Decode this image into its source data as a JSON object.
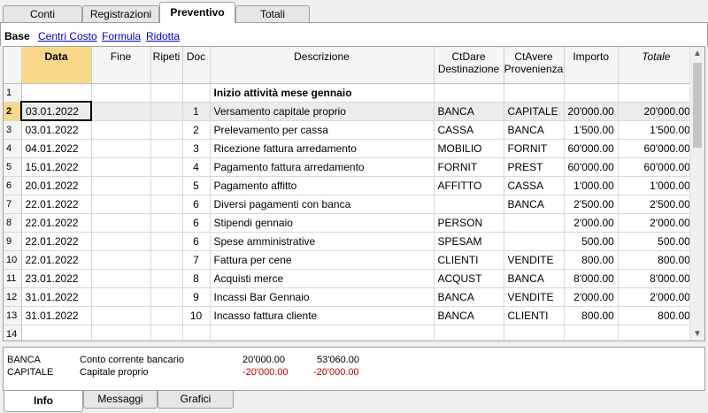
{
  "top_tabs": [
    "Conti",
    "Registrazioni",
    "Preventivo",
    "Totali"
  ],
  "active_top_tab": "Preventivo",
  "views": {
    "base": "Base",
    "links": [
      "Centri Costo",
      "Formula",
      "Ridotta"
    ]
  },
  "columns": [
    {
      "label": "Data"
    },
    {
      "label": "Fine"
    },
    {
      "label": "Ripeti"
    },
    {
      "label": "Doc"
    },
    {
      "label": "Descrizione"
    },
    {
      "label": "CtDare Destinazione"
    },
    {
      "label": "CtAvere Provenienza"
    },
    {
      "label": "Importo"
    },
    {
      "label": "Totale"
    }
  ],
  "rows": [
    {
      "n": "1",
      "data": "",
      "fine": "",
      "ripeti": "",
      "doc": "",
      "desc": "Inizio attività mese gennaio",
      "dare": "",
      "avere": "",
      "importo": "",
      "totale": ""
    },
    {
      "n": "2",
      "data": "03.01.2022",
      "fine": "",
      "ripeti": "",
      "doc": "1",
      "desc": "Versamento capitale proprio",
      "dare": "BANCA",
      "avere": "CAPITALE",
      "importo": "20'000.00",
      "totale": "20'000.00"
    },
    {
      "n": "3",
      "data": "03.01.2022",
      "fine": "",
      "ripeti": "",
      "doc": "2",
      "desc": "Prelevamento per cassa",
      "dare": "CASSA",
      "avere": "BANCA",
      "importo": "1'500.00",
      "totale": "1'500.00"
    },
    {
      "n": "4",
      "data": "04.01.2022",
      "fine": "",
      "ripeti": "",
      "doc": "3",
      "desc": "Ricezione fattura arredamento",
      "dare": "MOBILIO",
      "avere": "FORNIT",
      "importo": "60'000.00",
      "totale": "60'000.00"
    },
    {
      "n": "5",
      "data": "15.01.2022",
      "fine": "",
      "ripeti": "",
      "doc": "4",
      "desc": "Pagamento fattura arredamento",
      "dare": "FORNIT",
      "avere": "PREST",
      "importo": "60'000.00",
      "totale": "60'000.00"
    },
    {
      "n": "6",
      "data": "20.01.2022",
      "fine": "",
      "ripeti": "",
      "doc": "5",
      "desc": "Pagamento affitto",
      "dare": "AFFITTO",
      "avere": "CASSA",
      "importo": "1'000.00",
      "totale": "1'000.00"
    },
    {
      "n": "7",
      "data": "22.01.2022",
      "fine": "",
      "ripeti": "",
      "doc": "6",
      "desc": "Diversi pagamenti con banca",
      "dare": "",
      "avere": "BANCA",
      "importo": "2'500.00",
      "totale": "2'500.00"
    },
    {
      "n": "8",
      "data": "22.01.2022",
      "fine": "",
      "ripeti": "",
      "doc": "6",
      "desc": "Stipendi gennaio",
      "dare": "PERSON",
      "avere": "",
      "importo": "2'000.00",
      "totale": "2'000.00"
    },
    {
      "n": "9",
      "data": "22.01.2022",
      "fine": "",
      "ripeti": "",
      "doc": "6",
      "desc": "Spese amministrative",
      "dare": "SPESAM",
      "avere": "",
      "importo": "500.00",
      "totale": "500.00"
    },
    {
      "n": "10",
      "data": "22.01.2022",
      "fine": "",
      "ripeti": "",
      "doc": "7",
      "desc": "Fattura per cene",
      "dare": "CLIENTI",
      "avere": "VENDITE",
      "importo": "800.00",
      "totale": "800.00"
    },
    {
      "n": "11",
      "data": "23.01.2022",
      "fine": "",
      "ripeti": "",
      "doc": "8",
      "desc": "Acquisti merce",
      "dare": "ACQUST",
      "avere": "BANCA",
      "importo": "8'000.00",
      "totale": "8'000.00"
    },
    {
      "n": "12",
      "data": "31.01.2022",
      "fine": "",
      "ripeti": "",
      "doc": "9",
      "desc": "Incassi Bar Gennaio",
      "dare": "BANCA",
      "avere": "VENDITE",
      "importo": "2'000.00",
      "totale": "2'000.00"
    },
    {
      "n": "13",
      "data": "31.01.2022",
      "fine": "",
      "ripeti": "",
      "doc": "10",
      "desc": "Incasso fattura cliente",
      "dare": "BANCA",
      "avere": "CLIENTI",
      "importo": "800.00",
      "totale": "800.00"
    },
    {
      "n": "14",
      "data": "",
      "fine": "",
      "ripeti": "",
      "doc": "",
      "desc": "",
      "dare": "",
      "avere": "",
      "importo": "",
      "totale": ""
    }
  ],
  "info": [
    {
      "account": "BANCA",
      "description": "Conto corrente bancario",
      "amount1": "20'000.00",
      "amount2": "53'060.00"
    },
    {
      "account": "CAPITALE",
      "description": "Capitale proprio",
      "amount1": "-20'000.00",
      "amount2": "-20'000.00"
    }
  ],
  "bottom_tabs": [
    "Info",
    "Messaggi",
    "Grafici"
  ],
  "active_bottom_tab": "Info",
  "colors": {
    "selected_header": "#f9d88a",
    "link": "#0000cc",
    "negative": "#cc0000"
  }
}
